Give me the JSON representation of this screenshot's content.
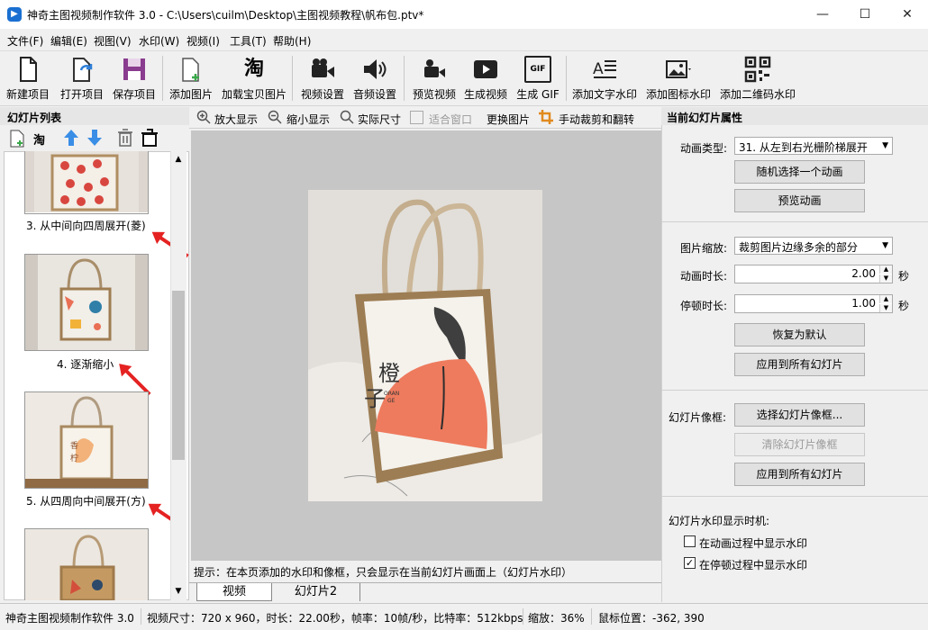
{
  "window": {
    "title": "神奇主图视频制作软件 3.0 - C:\\Users\\cuilm\\Desktop\\主图视频教程\\帆布包.ptv*",
    "minimize": "—",
    "maximize": "☐",
    "close": "✕"
  },
  "menu": [
    "文件(F)",
    "编辑(E)",
    "视图(V)",
    "水印(W)",
    "视频(I)",
    "工具(T)",
    "帮助(H)"
  ],
  "toolbar": [
    {
      "label": "新建项目",
      "icon": "new-file-icon"
    },
    {
      "label": "打开项目",
      "icon": "open-file-icon"
    },
    {
      "label": "保存项目",
      "icon": "save-icon"
    },
    {
      "label": "添加图片",
      "icon": "add-image-icon"
    },
    {
      "label": "加载宝贝图片",
      "icon": "taobao-icon",
      "glyph": "淘"
    },
    {
      "label": "视频设置",
      "icon": "video-camera-icon"
    },
    {
      "label": "音频设置",
      "icon": "speaker-icon"
    },
    {
      "label": "预览视频",
      "icon": "preview-camera-icon"
    },
    {
      "label": "生成视频",
      "icon": "play-icon"
    },
    {
      "label": "生成 GIF",
      "icon": "gif-icon",
      "glyph": "GIF"
    },
    {
      "label": "添加文字水印",
      "icon": "text-watermark-icon"
    },
    {
      "label": "添加图标水印",
      "icon": "image-watermark-icon"
    },
    {
      "label": "添加二维码水印",
      "icon": "qrcode-icon"
    }
  ],
  "left_panel": {
    "title": "幻灯片列表",
    "tools": [
      "add-slide-icon",
      "taobao-icon",
      "move-up-icon",
      "move-down-icon",
      "delete-icon",
      "clear-icon"
    ],
    "taobao_glyph": "淘",
    "slides": [
      {
        "caption": "3. 从中间向四周展开(菱)"
      },
      {
        "caption": "4. 逐渐缩小"
      },
      {
        "caption": "5. 从四周向中间展开(方)"
      },
      {
        "caption": ""
      }
    ]
  },
  "center": {
    "tools": [
      "放大显示",
      "缩小显示",
      "实际尺寸",
      "适合窗口",
      "更换图片",
      "手动裁剪和翻转"
    ],
    "canvas_text": {
      "brand_big": "橙",
      "brand_big2": "子",
      "brand_small1": "ORAN",
      "brand_small2": "GE"
    },
    "tip": "提示：在本页添加的水印和像框，只会显示在当前幻灯片画面上（幻灯片水印）",
    "tabs": [
      "视频",
      "幻灯片2"
    ]
  },
  "right_panel": {
    "title": "当前幻灯片属性",
    "animation_type_label": "动画类型:",
    "animation_type_value": "31. 从左到右光栅阶梯展开",
    "random_button": "随机选择一个动画",
    "preview_button": "预览动画",
    "scale_label": "图片缩放:",
    "scale_value": "裁剪图片边缘多余的部分",
    "duration_label": "动画时长:",
    "duration_value": "2.00",
    "pause_label": "停顿时长:",
    "pause_value": "1.00",
    "unit_sec": "秒",
    "restore_button": "恢复为默认",
    "apply_all_button": "应用到所有幻灯片",
    "frame_label": "幻灯片像框:",
    "choose_frame_button": "选择幻灯片像框...",
    "clear_frame_button": "清除幻灯片像框",
    "apply_frame_all_button": "应用到所有幻灯片",
    "watermark_timing_label": "幻灯片水印显示时机:",
    "chk_animation": {
      "label": "在动画过程中显示水印",
      "checked": false
    },
    "chk_pause": {
      "label": "在停顿过程中显示水印",
      "checked": true
    }
  },
  "statusbar": {
    "app": "神奇主图视频制作软件 3.0",
    "info": "视频尺寸：720 x 960，时长：22.00秒，帧率：10帧/秒，比特率：512kbps",
    "zoom": "缩放：36%",
    "mouse": "鼠标位置：-362, 390"
  },
  "colors": {
    "accent_blue": "#3a8ee6",
    "save_purple": "#8a3c8e",
    "arrow_red": "#e52222",
    "bag_orange": "#ee7b5e"
  }
}
